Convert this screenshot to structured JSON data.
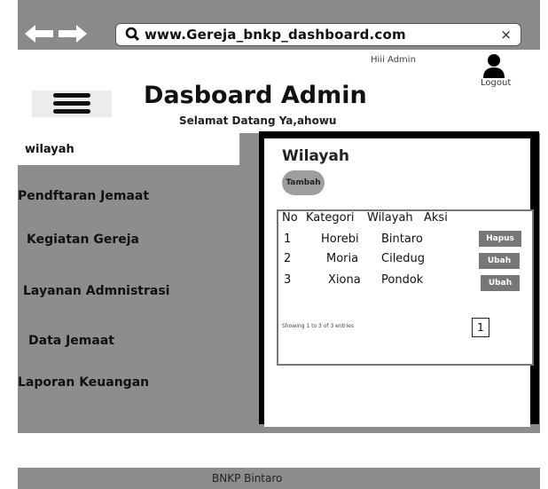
{
  "browser": {
    "url": "www.Gereja_bnkp_dashboard.com",
    "close_glyph": "×",
    "icons": {
      "back": "arrow-left-icon",
      "forward": "arrow-right-icon",
      "search": "search-icon",
      "close": "close-icon"
    }
  },
  "header": {
    "greeting": "Hiii Admin",
    "logout_label": "Logout",
    "title": "Dasboard Admin",
    "subtitle": "Selamat Datang Ya,ahowu",
    "icons": {
      "menu": "hamburger-menu-icon",
      "user": "user-icon"
    }
  },
  "sidebar": {
    "items": [
      {
        "label": "wilayah",
        "active": true
      },
      {
        "label": "Pendftaran Jemaat",
        "active": false
      },
      {
        "label": "Kegiatan Gereja",
        "active": false
      },
      {
        "label": "Layanan Admnistrasi",
        "active": false
      },
      {
        "label": "Data Jemaat",
        "active": false
      },
      {
        "label": "Laporan Keuangan",
        "active": false
      }
    ]
  },
  "main": {
    "title": "Wilayah",
    "add_button": "Tambah",
    "table": {
      "columns": [
        "No",
        "Kategori",
        "Wilayah",
        "Aksi"
      ],
      "rows": [
        {
          "no": "1",
          "kategori": "Horebi",
          "wilayah": "Bintaro",
          "aksi": "Hapus"
        },
        {
          "no": "2",
          "kategori": "Moria",
          "wilayah": "Ciledug",
          "aksi": "Ubah"
        },
        {
          "no": "3",
          "kategori": "Xiona",
          "wilayah": "Pondok",
          "aksi": "Ubah"
        }
      ]
    },
    "showing_text": "Showing 1 to 3 of 3 entries",
    "page_number": "1"
  },
  "footer": {
    "text": "BNKP Bintaro"
  },
  "colors": {
    "gray_panel": "#8d8d8d",
    "browser_bar": "#8a8a8a",
    "panel_border": "#000000",
    "button_gray": "#777777"
  }
}
